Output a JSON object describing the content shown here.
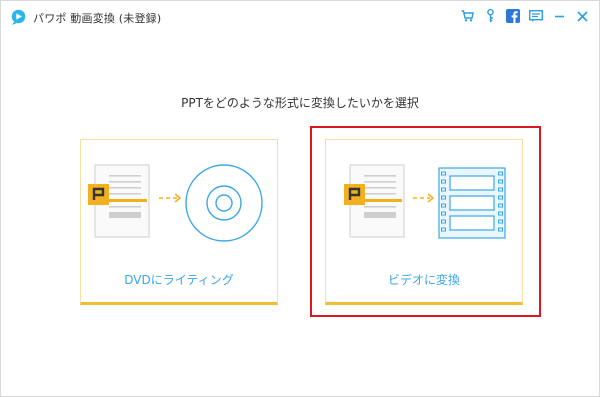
{
  "app": {
    "title": "パワポ 動画変換 (未登録)"
  },
  "toolbar": {
    "icons": [
      "cart-icon",
      "key-icon",
      "facebook-icon",
      "feedback-icon",
      "minimize-icon",
      "close-icon"
    ]
  },
  "main": {
    "prompt": "PPTをどのような形式に変換したいかを選択",
    "options": [
      {
        "label": "DVDにライティング",
        "icon": "dvd-disc-icon",
        "selected": false
      },
      {
        "label": "ビデオに変換",
        "icon": "film-strip-icon",
        "selected": true
      }
    ]
  },
  "colors": {
    "accent_blue": "#3aa6e6",
    "card_accent": "#f2bc34",
    "selection": "#d9191f",
    "ppt_orange": "#f2b01e"
  }
}
